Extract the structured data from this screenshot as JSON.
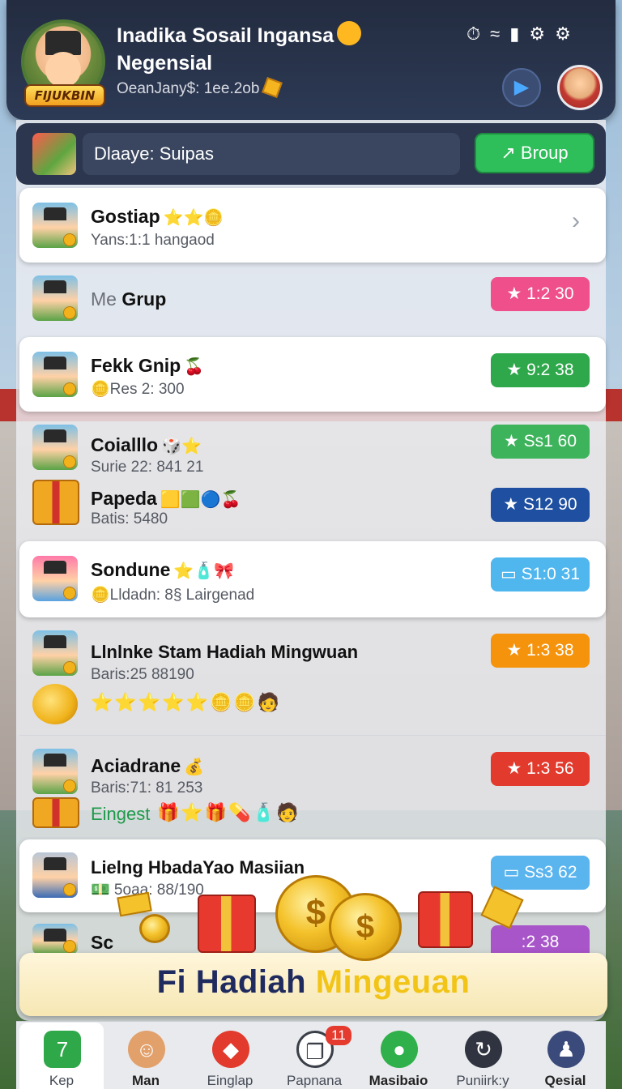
{
  "header": {
    "title_line1": "Inadika Sosail Ingansa",
    "title_line2": "Negensial",
    "coins_text": "OeanJany$: 1ee.2ob",
    "avatar_badge": "FIJUKBIN",
    "status_icons": [
      "timer-icon",
      "wifi-icon",
      "signal-icon",
      "settings-icon"
    ]
  },
  "search": {
    "value": "Dlaaye: Suipas"
  },
  "group_button": {
    "label": "↗ Broup"
  },
  "rows": [
    {
      "name": "Gostiap",
      "deco": "⭐⭐🪙",
      "sub": "Yans:1:1 hangaod",
      "pill": "",
      "pill_color": "",
      "chevron": "›"
    },
    {
      "name_prefix": "Me",
      "name": "Grup",
      "deco": "",
      "sub": "",
      "pill": "★ 1:2 30",
      "pill_color": "#ef4f8a"
    },
    {
      "name": "Fekk Gnip",
      "deco": "🍒",
      "sub": "🪙Res 2: 300",
      "pill": "★ 9:2 38",
      "pill_color": "#2ea84b"
    },
    {
      "name": "Coialllo",
      "deco": "🎲⭐",
      "sub": "Surie 22: 841 21",
      "pill": "★ Ss1 60",
      "pill_color": "#3db35c"
    },
    {
      "name": "Papeda",
      "deco": "🟨🟩🔵🍒",
      "sub": "Batis: 5480",
      "pill": "★ S12 90",
      "pill_color": "#1e4fa0"
    },
    {
      "name": "Sondune",
      "deco": "⭐🧴🎀",
      "sub": "🪙Lldadn: 8§ Lairgenad",
      "pill": "▭ S1:0 31",
      "pill_color": "#4fb6ee"
    },
    {
      "name": "Llnlnke Stam Hadiah Mingwuan",
      "deco": "",
      "sub": "Baris:25 88190",
      "extra": "⭐⭐⭐⭐⭐🪙🪙🧑",
      "pill": "★ 1:3 38",
      "pill_color": "#f5930c"
    },
    {
      "name": "Aciadrane",
      "deco": "💰",
      "sub": "Baris:71: 81 253",
      "extra_label": "Eingest",
      "extra": "🎁⭐🎁💊🧴🧑",
      "pill": "★ 1:3 56",
      "pill_color": "#e23a2c"
    },
    {
      "name": "Lielng HbadaYao Masiian",
      "deco": "",
      "sub": "💵 5oaa: 88/190",
      "pill": "▭ Ss3 62",
      "pill_color": "#5ab4ee"
    },
    {
      "name": "Sc",
      "deco": "",
      "sub": "",
      "pill": ":2 38",
      "pill_color": "#a855c9"
    }
  ],
  "banner": {
    "title_a": "Fi Hadiah ",
    "title_b": "Mingeuan",
    "coin_symbol": "$"
  },
  "nav": [
    {
      "label": "Kep",
      "icon": "home-icon",
      "glyph": "7",
      "color": "#2fa84a",
      "active": true
    },
    {
      "label": "Man",
      "icon": "profile-icon",
      "glyph": "☺",
      "color": "#e2a06b"
    },
    {
      "label": "Einglap",
      "icon": "chat-icon",
      "glyph": "◆",
      "color": "#e23a2c"
    },
    {
      "label": "Papnana",
      "icon": "message-icon",
      "glyph": "❐",
      "color": "#3b3f48",
      "badge": "11"
    },
    {
      "label": "Masibaio",
      "icon": "balloon-icon",
      "glyph": "●",
      "color": "#2fb04a"
    },
    {
      "label": "Puniirk:y",
      "icon": "refresh-icon",
      "glyph": "↻",
      "color": "#2f3440"
    },
    {
      "label": "Qesial",
      "icon": "user-icon",
      "glyph": "♟",
      "color": "#3a4a7a"
    }
  ]
}
